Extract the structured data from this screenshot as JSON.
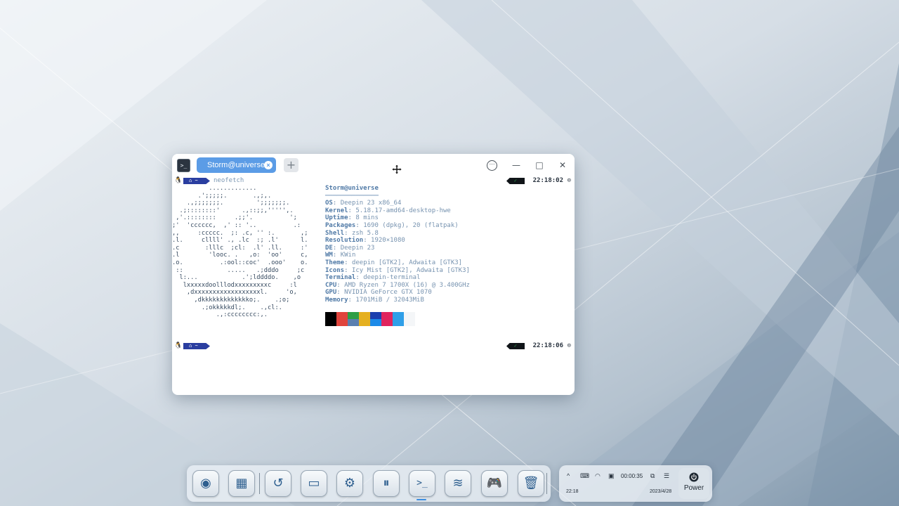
{
  "window": {
    "app_icon": ">_",
    "tab_title": "Storm@universe:~",
    "tab_close": "×",
    "tab_add": "+",
    "menu": "⋯",
    "minimize": "—",
    "maximize": "□",
    "close": "✕"
  },
  "terminal": {
    "prompt1": {
      "home": "~",
      "command": "neofetch",
      "status": "✓",
      "time": "22:18:02"
    },
    "prompt2": {
      "home": "~",
      "command": "",
      "status": "✓",
      "time": "22:18:06"
    },
    "ascii_logo": "          .............\n       .';;;;;.       .,;,.\n    .,;;;;;;;.         ';;;;;;;.\n  .;::::::::'      .,::;;,''''',.\n ,'.::::::::     .;;'.          ';\n;'  'cccccc,  ,' :: '..          .:\n,,     :ccccc.  ;: .c, '' :.       ,;\n.l.     cllll' ., .lc  :; .l'      l.\n.c       :lllc  ;cl:  .l' .ll.     :'\n.l        'looc. .   ,o:  'oo'     c,\n.o.          .:ool::coc'  .ooo'    o.\n ::            .....   .;dddo     ;c\n  l:...            .';lddddo.    ,o\n   lxxxxxdoolllodxxxxxxxxxc     :l\n    ,dxxxxxxxxxxxxxxxxxxl.     'o,\n      ,dkkkkkkkkkkkkko;.    .;o;\n        .;okkkkkdl;.    .,cl:.\n            .,:cccccccc:,.",
    "user_host": "Storm@universe",
    "separator": "──────────────",
    "info": [
      {
        "key": "OS",
        "value": "Deepin 23 x86_64"
      },
      {
        "key": "Kernel",
        "value": "5.18.17-amd64-desktop-hwe"
      },
      {
        "key": "Uptime",
        "value": "8 mins"
      },
      {
        "key": "Packages",
        "value": "1690 (dpkg), 20 (flatpak)"
      },
      {
        "key": "Shell",
        "value": "zsh 5.8"
      },
      {
        "key": "Resolution",
        "value": "1920×1080"
      },
      {
        "key": "DE",
        "value": "Deepin 23"
      },
      {
        "key": "WM",
        "value": "KWin"
      },
      {
        "key": "Theme",
        "value": "deepin [GTK2], Adwaita [GTK3]"
      },
      {
        "key": "Icons",
        "value": "Icy Mist [GTK2], Adwaita [GTK3]"
      },
      {
        "key": "Terminal",
        "value": "deepin-terminal"
      },
      {
        "key": "CPU",
        "value": "AMD Ryzen 7 1700X (16) @ 3.400GHz"
      },
      {
        "key": "GPU",
        "value": "NVIDIA GeForce GTX 1070"
      },
      {
        "key": "Memory",
        "value": "1701MiB / 32043MiB"
      }
    ],
    "palette_top": [
      "#000000",
      "#e0443c",
      "#2e9e44",
      "#e5b020",
      "#1c3fae",
      "#e0245e",
      "#2f9fe8",
      "#f4f6f8"
    ],
    "palette_bottom": [
      "#000000",
      "#e0443c",
      "#5a7fb0",
      "#e5b020",
      "#1c8ae8",
      "#e0245e",
      "#2f9fe8",
      "#f4f6f8"
    ]
  },
  "dock": {
    "items": [
      {
        "name": "launcher",
        "glyph": "◉"
      },
      {
        "name": "multitask-view",
        "glyph": "▦"
      },
      {
        "name": "backup-restore",
        "glyph": "↺"
      },
      {
        "name": "file-manager",
        "glyph": "▭"
      },
      {
        "name": "control-center",
        "glyph": "⚙"
      },
      {
        "name": "settings-toggles",
        "glyph": "⏸"
      },
      {
        "name": "terminal",
        "glyph": ">_"
      },
      {
        "name": "network-stream",
        "glyph": "≋"
      },
      {
        "name": "game-controller",
        "glyph": "🎮"
      },
      {
        "name": "trash",
        "glyph": "🗑"
      }
    ]
  },
  "tray": {
    "expand": "^",
    "record_time": "00:00:35",
    "time": "22:18",
    "date": "2023/4/28",
    "power_label": "Power"
  }
}
